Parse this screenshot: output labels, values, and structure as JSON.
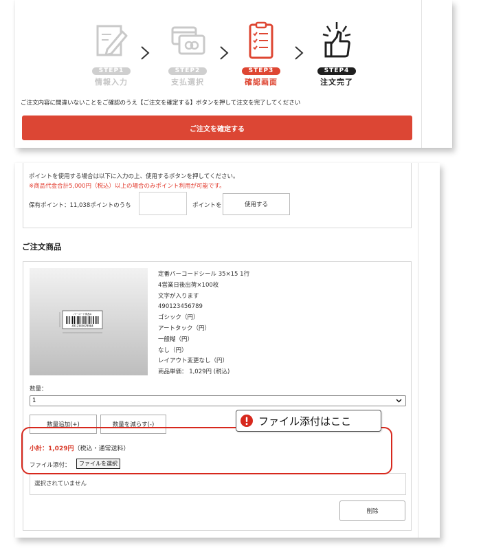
{
  "steps": [
    {
      "badge": "STEP1",
      "name": "情報入力",
      "icon": "pencil-document-icon"
    },
    {
      "badge": "STEP2",
      "name": "支払選択",
      "icon": "credit-card-icon"
    },
    {
      "badge": "STEP3",
      "name": "確認画面",
      "icon": "clipboard-checklist-icon"
    },
    {
      "badge": "STEP4",
      "name": "注文完了",
      "icon": "thumbs-up-icon"
    }
  ],
  "instruction": "ご注文内容に間違いないことをご確認のうえ【ご注文を確定する】ボタンを押して注文を完了してください",
  "confirm_button": "ご注文を確定する",
  "points": {
    "line1": "ポイントを使用する場合は以下に入力の上、使用するボタンを押してください。",
    "line2": "※商品代金合計5,000円（税込）以上の場合のみポイント利用が可能です。",
    "held": "保有ポイント：11,038ポイントのうち",
    "unit": "ポイントを",
    "use_button": "使用する"
  },
  "order_section_title": "ご注文商品",
  "product": {
    "sticker_title": "バーコード商品A",
    "sticker_code": "4912345678904",
    "details": [
      "定番バーコードシール 35×15 1行",
      "4営業日後出荷×100枚",
      "文字が入ります",
      "490123456789",
      "ゴシック（円）",
      "アートタック（円）",
      "一般糊（円）",
      "なし（円）",
      "レイアウト変更なし（円）",
      "商品単価： 1,029円 (税込)"
    ]
  },
  "quantity": {
    "label": "数量：",
    "value": "1"
  },
  "buttons": {
    "add": "数量追加(+)",
    "reduce": "数量を減らす(-)",
    "file": "ファイルを選択",
    "delete": "削除"
  },
  "subtotal": {
    "label_amount": "小計：1,029円",
    "note": "（税込・通常送料）"
  },
  "attach_label": "ファイル添付：",
  "file_status": "選択されていません",
  "callout": "ファイル添付はここ",
  "colors": {
    "accent_red": "#dc4634",
    "dark": "#1f1f1f",
    "gray": "#cfcfcf"
  }
}
